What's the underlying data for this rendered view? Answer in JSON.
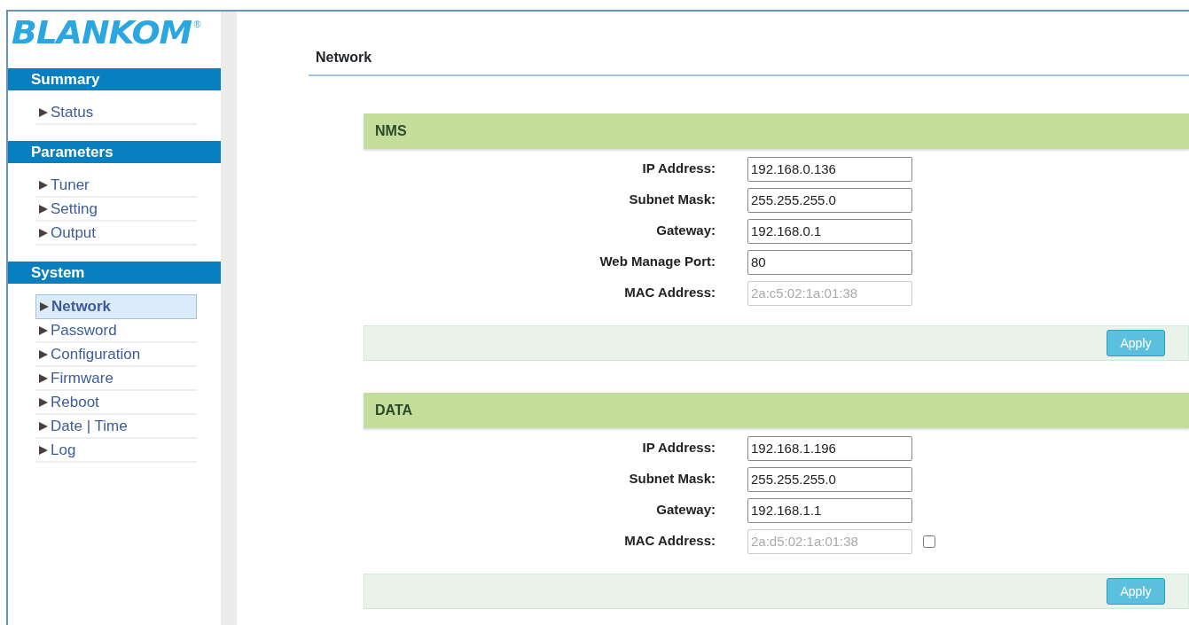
{
  "logo": {
    "text": "BLANKOM",
    "mark": "®"
  },
  "sidebar": [
    {
      "title": "Summary",
      "items": [
        {
          "label": "Status",
          "selected": false
        }
      ]
    },
    {
      "title": "Parameters",
      "items": [
        {
          "label": "Tuner",
          "selected": false
        },
        {
          "label": "Setting",
          "selected": false
        },
        {
          "label": "Output",
          "selected": false
        }
      ]
    },
    {
      "title": "System",
      "items": [
        {
          "label": "Network",
          "selected": true
        },
        {
          "label": "Password",
          "selected": false
        },
        {
          "label": "Configuration",
          "selected": false
        },
        {
          "label": "Firmware",
          "selected": false
        },
        {
          "label": "Reboot",
          "selected": false
        },
        {
          "label": "Date | Time",
          "selected": false
        },
        {
          "label": "Log",
          "selected": false
        }
      ]
    }
  ],
  "page_title": "Network",
  "sections": [
    {
      "title": "NMS",
      "fields": [
        {
          "label": "IP Address:",
          "value": "192.168.0.136",
          "disabled": false
        },
        {
          "label": "Subnet Mask:",
          "value": "255.255.255.0",
          "disabled": false
        },
        {
          "label": "Gateway:",
          "value": "192.168.0.1",
          "disabled": false
        },
        {
          "label": "Web Manage Port:",
          "value": "80",
          "disabled": false
        },
        {
          "label": "MAC Address:",
          "value": "2a:c5:02:1a:01:38",
          "disabled": true
        }
      ],
      "button": "Apply"
    },
    {
      "title": "DATA",
      "fields": [
        {
          "label": "IP Address:",
          "value": "192.168.1.196",
          "disabled": false
        },
        {
          "label": "Subnet Mask:",
          "value": "255.255.255.0",
          "disabled": false
        },
        {
          "label": "Gateway:",
          "value": "192.168.1.1",
          "disabled": false
        },
        {
          "label": "MAC Address:",
          "value": "2a:d5:02:1a:01:38",
          "disabled": true,
          "checkbox": {
            "checked": false
          }
        }
      ],
      "button": "Apply"
    }
  ]
}
